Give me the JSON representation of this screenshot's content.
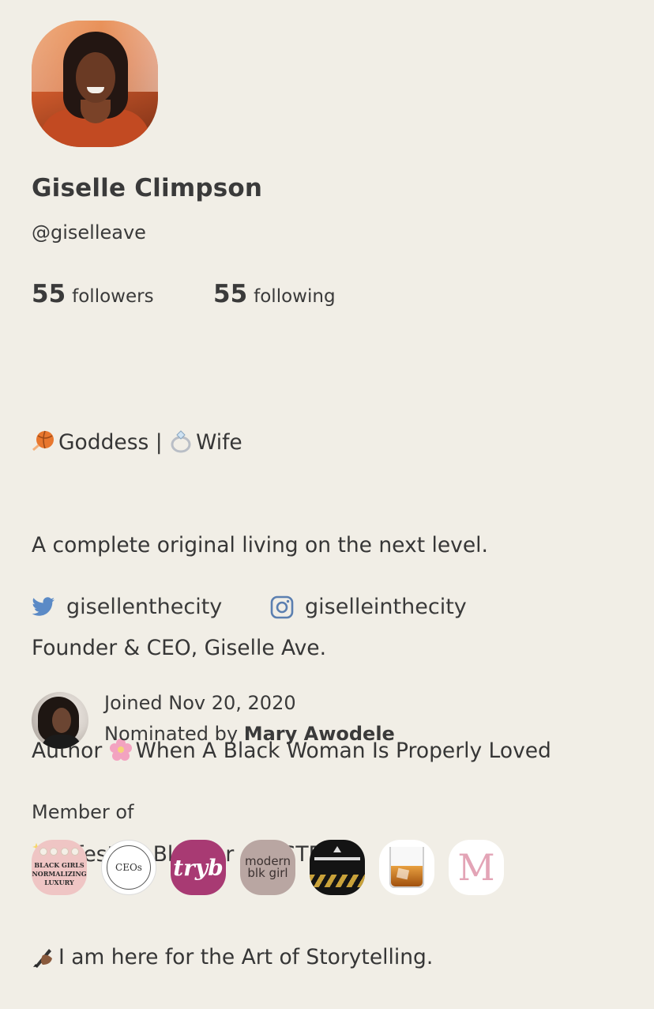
{
  "profile": {
    "name": "Giselle Climpson",
    "handle": "@giselleave",
    "followers_count": "55",
    "followers_label": "followers",
    "following_count": "55",
    "following_label": "following"
  },
  "bio": {
    "line1_a": "Goddess | ",
    "line1_b": "Wife",
    "line2": "A complete original living on the next level.",
    "line3": "Founder & CEO, Giselle Ave.",
    "line4_a": "Author ",
    "line4_b": "When A Black Woman Is Properly Loved",
    "line5": "Lifestyle Blogger + #STEAM",
    "line6": "I am here for the Art of Storytelling."
  },
  "social": {
    "twitter": "gisellenthecity",
    "instagram": "giselleinthecity"
  },
  "meta": {
    "joined": "Joined Nov 20, 2020",
    "nominated_prefix": "Nominated by ",
    "nominated_by": "Mary Awodele"
  },
  "members": {
    "label": "Member of",
    "clubs": [
      {
        "text": "BLACK GIRLS NORMALIZING LUXURY"
      },
      {
        "text": "CEOs"
      },
      {
        "text": "tryb"
      },
      {
        "text": "modern blk girl"
      },
      {
        "text": ""
      },
      {
        "text": ""
      },
      {
        "text": "M"
      }
    ]
  },
  "colors": {
    "background": "#f1eee6",
    "text": "#3a3a3a",
    "twitter_blue": "#5b8ac6",
    "instagram_icon": "#5b7fb0"
  }
}
